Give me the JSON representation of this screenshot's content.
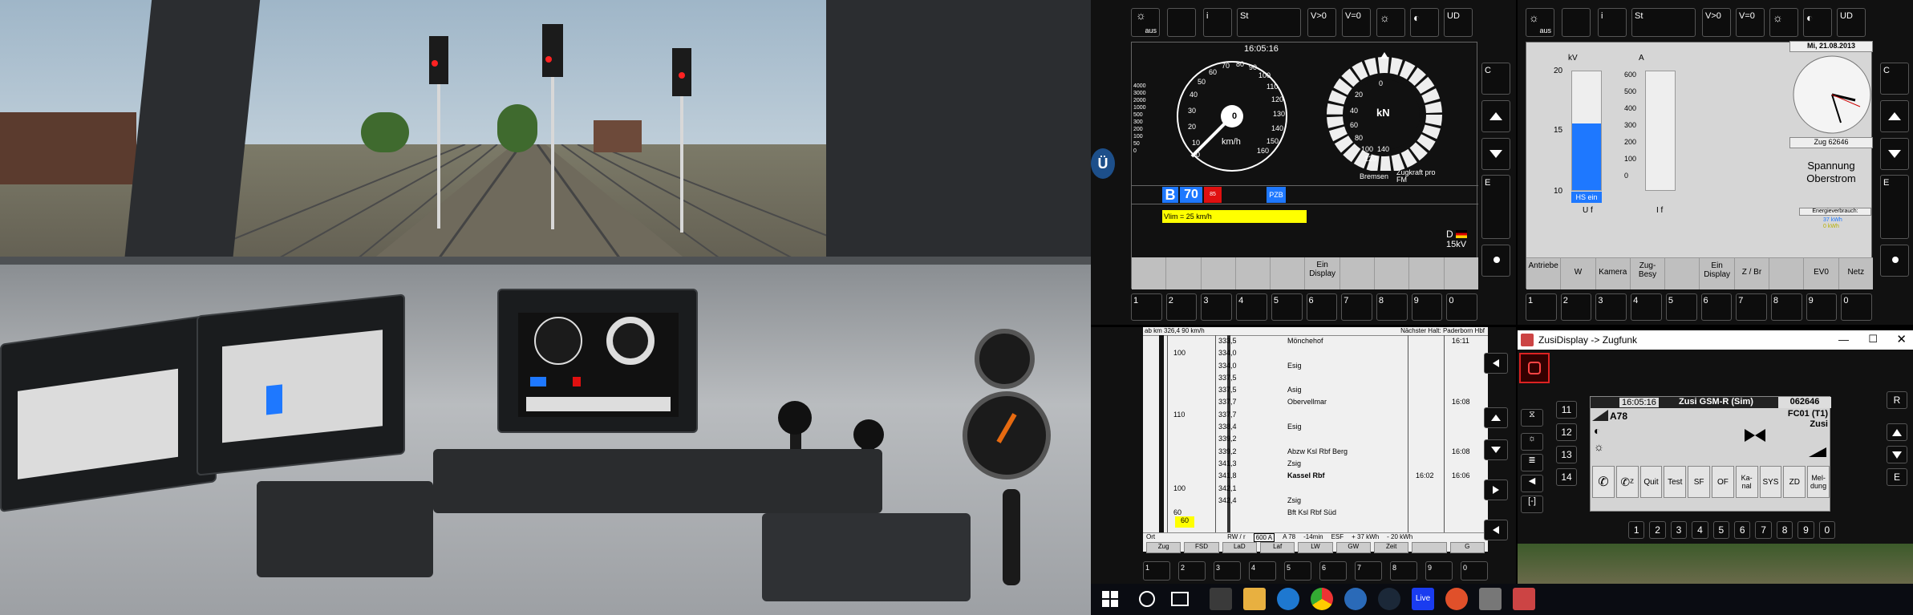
{
  "afb_display": {
    "top_buttons": [
      "aus",
      "i",
      "St",
      "V>0",
      "V=0",
      "UD"
    ],
    "clock": "16:05:16",
    "speed_unit": "km/h",
    "speed_value": "0",
    "speed_ticks": [
      "0",
      "10",
      "20",
      "30",
      "40",
      "50",
      "60",
      "70",
      "80",
      "90",
      "100",
      "110",
      "120",
      "130",
      "140",
      "150",
      "160"
    ],
    "force_unit": "kN",
    "force_labels": [
      "Bremsen",
      "Zugkraft pro FM"
    ],
    "force_ticks": [
      "0",
      "20",
      "40",
      "60",
      "80",
      "100",
      "120",
      "140"
    ],
    "scale_values": [
      "4000",
      "3000",
      "2000",
      "1000",
      "500",
      "300",
      "200",
      "100",
      "50",
      "0"
    ],
    "train_mode": "B",
    "vmax": "70",
    "red_indicator": "85",
    "pzb": "PZB",
    "vlim_text": "Vlim = 25 km/h",
    "voltage": "15kV",
    "country": "D",
    "soft_keys": [
      "",
      "",
      "",
      "",
      "",
      "Ein Display",
      "",
      "",
      "",
      ""
    ],
    "right_side": [
      "C",
      "E"
    ],
    "numbers": [
      "1",
      "2",
      "3",
      "4",
      "5",
      "6",
      "7",
      "8",
      "9",
      "0"
    ]
  },
  "power_display": {
    "top_buttons": [
      "aus",
      "i",
      "St",
      "V>0",
      "V=0",
      "UD"
    ],
    "volt_label": "kV",
    "volt_ticks": [
      "20",
      "15",
      "10"
    ],
    "volt_level": 0.56,
    "hs_label": "HS ein",
    "uf_label": "U f",
    "amp_label": "A",
    "amp_ticks": [
      "600",
      "500",
      "400",
      "300",
      "200",
      "100",
      "0"
    ],
    "if_label": "I f",
    "date": "Mi, 21.08.2013",
    "train_number": "Zug 62646",
    "title_line1": "Spannung",
    "title_line2": "Oberstrom",
    "energy_label": "Energieverbrauch:",
    "energy_1": "37 kWh",
    "energy_2": "0 kWh",
    "soft_keys": [
      "Antriebe",
      "W",
      "Kamera",
      "Zug-Besy",
      "",
      "Ein Display",
      "Z / Br",
      "",
      "EV0",
      "Netz"
    ],
    "right_side": [
      "C",
      "E"
    ],
    "numbers": [
      "1",
      "2",
      "3",
      "4",
      "5",
      "6",
      "7",
      "8",
      "9",
      "0"
    ]
  },
  "timetable": {
    "header_left": "ab km 326,4  90 km/h",
    "header_right": "Nächster Halt: Paderborn Hbf",
    "rows": [
      {
        "speed": "",
        "km": "333,5",
        "station": "Mönchehof",
        "arr": "",
        "dep": "16:11"
      },
      {
        "speed": "100",
        "km": "334,0",
        "station": "",
        "arr": "",
        "dep": ""
      },
      {
        "speed": "",
        "km": "334,0",
        "station": "Esig",
        "arr": "",
        "dep": ""
      },
      {
        "speed": "",
        "km": "337,5",
        "station": "",
        "arr": "",
        "dep": ""
      },
      {
        "speed": "",
        "km": "337,5",
        "station": "Asig",
        "arr": "",
        "dep": ""
      },
      {
        "speed": "",
        "km": "337,7",
        "station": "Obervellmar",
        "arr": "",
        "dep": "16:08"
      },
      {
        "speed": "110",
        "km": "337,7",
        "station": "",
        "arr": "",
        "dep": ""
      },
      {
        "speed": "",
        "km": "338,4",
        "station": "Esig",
        "arr": "",
        "dep": ""
      },
      {
        "speed": "",
        "km": "339,2",
        "station": "",
        "arr": "",
        "dep": ""
      },
      {
        "speed": "",
        "km": "339,2",
        "station": "Abzw Ksl Rbf Berg",
        "arr": "",
        "dep": "16:08"
      },
      {
        "speed": "",
        "km": "341,3",
        "station": "Zsig",
        "arr": "",
        "dep": ""
      },
      {
        "speed": "",
        "km": "341,8",
        "station": "Kassel Rbf",
        "arr": "16:02",
        "dep": "16:06"
      },
      {
        "speed": "100",
        "km": "342,1",
        "station": "",
        "arr": "",
        "dep": ""
      },
      {
        "speed": "",
        "km": "342,4",
        "station": "Zsig",
        "arr": "",
        "dep": ""
      },
      {
        "speed": "60",
        "km": "",
        "station": "Bft Ksl Rbf Süd",
        "arr": "",
        "dep": ""
      }
    ],
    "status": [
      "Ort",
      "RW / r",
      "600 A",
      "A 78",
      "-14min",
      "ESF",
      "+ 37 kWh",
      "- 20 kWh"
    ],
    "buttons": [
      "Zug",
      "FSD",
      "LaD",
      "Laf",
      "LW",
      "GW",
      "Zeit",
      "",
      "G"
    ],
    "numbers": [
      "1",
      "2",
      "3",
      "4",
      "5",
      "6",
      "7",
      "8",
      "9",
      "0"
    ]
  },
  "zugfunk": {
    "window_title": "ZusiDisplay -> Zugfunk",
    "time": "16:05:16",
    "title": "Zusi GSM-R (Sim)",
    "number": "062646",
    "fc": "FC01 (T1)",
    "operator": "Zusi",
    "route": "A78",
    "side_numbers": [
      "11",
      "12",
      "13",
      "14"
    ],
    "buttons": [
      "Quit",
      "Test",
      "SF",
      "OF",
      "Ka-nal",
      "SYS",
      "ZD",
      "Mel-dung"
    ],
    "right_buttons": [
      "R",
      "E"
    ],
    "numbers": [
      "1",
      "2",
      "3",
      "4",
      "5",
      "6",
      "7",
      "8",
      "9",
      "0"
    ]
  },
  "taskbar": {
    "live_label": "Live"
  },
  "colors": {
    "highlight_blue": "#1e78ff",
    "vlim_yellow": "#ffff00",
    "alarm_red": "#e01010"
  }
}
